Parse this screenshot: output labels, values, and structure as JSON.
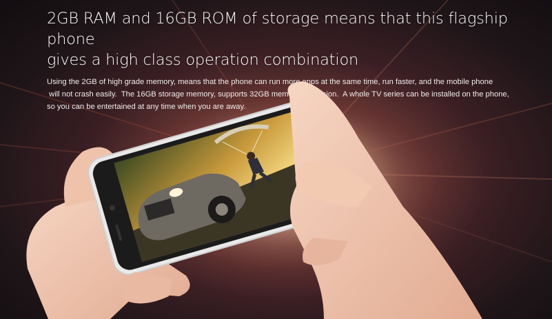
{
  "headline": {
    "line1": "2GB RAM and 16GB ROM of storage means that this  flagship phone",
    "line2": "gives a high class operation combination"
  },
  "body": {
    "line1": "Using the 2GB of high grade memory, means that the phone can run more apps at the same time, run faster, and the mobile phone",
    "line2": " will not crash easily.  The 16GB storage memory, supports 32GB memory expansion.  A whole TV series can be installed on the phone,",
    "line3": "so you can be entertained at any time when you are away."
  },
  "colors": {
    "background_center": "#e9d9c9",
    "background_edge": "#120d10",
    "phone_frame": "#f2f2f2",
    "skin": "#f1c9b3"
  },
  "icons": {
    "back": "chevron-icon",
    "recent": "square-icon"
  }
}
